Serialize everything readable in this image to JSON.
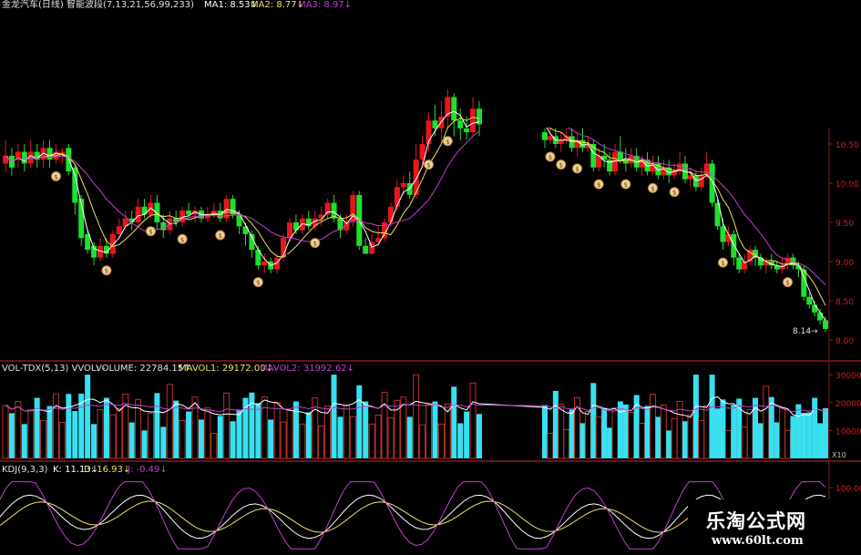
{
  "colors": {
    "up": "#e8161b",
    "down": "#1ee02e",
    "ma1": "#ffffff",
    "ma2": "#f0e060",
    "ma3": "#c040d0",
    "vol_up": "#c0302a",
    "vol_down": "#38e0f0",
    "axis": "#8b1a1a",
    "tick": "#cc2222",
    "kdj_k": "#ffffff",
    "kdj_d": "#f0e060",
    "kdj_j": "#c040d0"
  },
  "header": {
    "title": "金龙汽车(日线) 智能波段(7,13,21,56,99,233)",
    "ma1": "MA1: 8.53↓",
    "ma2": "MA2: 8.77↓",
    "ma3": "MA3: 8.97↓"
  },
  "vol_header": {
    "name": "VOL-TDX(5,13) VVOL: -",
    "volume": "VOLUME: 22784.15↑",
    "mavol1": "MAVOL1: 29172.00↓",
    "mavol2": "MAVOL2: 31992.62↓"
  },
  "kdj_header": {
    "name": "KDJ(9,3,3)",
    "k": "K: 11.13↓",
    "d": "D: 16.93↓",
    "j": "J: -0.49↓"
  },
  "watermark": {
    "name": "乐淘公式网",
    "url": "www.60lt.com"
  },
  "chart_data": [
    {
      "type": "candlestick",
      "title": "金龙汽车(日线) 智能波段(7,13,21,56,99,233)",
      "ylim": [
        7.95,
        10.75
      ],
      "yticks": [
        "10.50",
        "10.00",
        "9.50",
        "9.00",
        "8.50",
        "8.00"
      ],
      "last_price_label": "8.14",
      "candles": [
        [
          10.25,
          10.35,
          10.55,
          10.15
        ],
        [
          10.35,
          10.2,
          10.45,
          10.1
        ],
        [
          10.3,
          10.4,
          10.5,
          10.2
        ],
        [
          10.4,
          10.25,
          10.5,
          10.15
        ],
        [
          10.25,
          10.4,
          10.55,
          10.2
        ],
        [
          10.4,
          10.3,
          10.5,
          10.2
        ],
        [
          10.3,
          10.45,
          10.55,
          10.2
        ],
        [
          10.45,
          10.3,
          10.55,
          10.2
        ],
        [
          10.3,
          10.4,
          10.5,
          10.25
        ],
        [
          10.35,
          10.4,
          10.45,
          10.25
        ],
        [
          10.45,
          10.15,
          10.5,
          10.1
        ],
        [
          10.2,
          9.75,
          10.25,
          9.6
        ],
        [
          9.8,
          9.3,
          9.85,
          9.2
        ],
        [
          9.35,
          9.15,
          9.4,
          9.1
        ],
        [
          9.2,
          9.05,
          9.25,
          8.95
        ],
        [
          9.05,
          9.2,
          9.3,
          9.0
        ],
        [
          9.2,
          9.1,
          9.3,
          9.05
        ],
        [
          9.1,
          9.35,
          9.4,
          9.05
        ],
        [
          9.35,
          9.45,
          9.55,
          9.3
        ],
        [
          9.45,
          9.55,
          9.65,
          9.4
        ],
        [
          9.55,
          9.5,
          9.65,
          9.4
        ],
        [
          9.5,
          9.7,
          9.8,
          9.45
        ],
        [
          9.7,
          9.6,
          9.8,
          9.55
        ],
        [
          9.6,
          9.75,
          9.85,
          9.55
        ],
        [
          9.75,
          9.5,
          9.85,
          9.4
        ],
        [
          9.5,
          9.4,
          9.6,
          9.3
        ],
        [
          9.4,
          9.55,
          9.65,
          9.35
        ],
        [
          9.55,
          9.5,
          9.65,
          9.45
        ],
        [
          9.5,
          9.65,
          9.7,
          9.45
        ],
        [
          9.65,
          9.6,
          9.75,
          9.55
        ],
        [
          9.6,
          9.65,
          9.7,
          9.5
        ],
        [
          9.65,
          9.55,
          9.7,
          9.5
        ],
        [
          9.55,
          9.6,
          9.7,
          9.5
        ],
        [
          9.6,
          9.65,
          9.75,
          9.55
        ],
        [
          9.65,
          9.55,
          9.75,
          9.5
        ],
        [
          9.55,
          9.8,
          9.85,
          9.5
        ],
        [
          9.8,
          9.6,
          9.85,
          9.55
        ],
        [
          9.6,
          9.45,
          9.65,
          9.35
        ],
        [
          9.45,
          9.35,
          9.5,
          9.2
        ],
        [
          9.35,
          9.15,
          9.4,
          9.05
        ],
        [
          9.15,
          8.95,
          9.2,
          8.9
        ],
        [
          8.95,
          9.0,
          9.1,
          8.85
        ],
        [
          9.0,
          8.9,
          9.05,
          8.85
        ],
        [
          8.9,
          9.05,
          9.1,
          8.85
        ],
        [
          9.05,
          9.3,
          9.35,
          9.0
        ],
        [
          9.3,
          9.5,
          9.55,
          9.25
        ],
        [
          9.5,
          9.4,
          9.6,
          9.35
        ],
        [
          9.4,
          9.55,
          9.6,
          9.35
        ],
        [
          9.55,
          9.45,
          9.65,
          9.4
        ],
        [
          9.45,
          9.55,
          9.65,
          9.4
        ],
        [
          9.55,
          9.6,
          9.7,
          9.45
        ],
        [
          9.6,
          9.75,
          9.8,
          9.55
        ],
        [
          9.75,
          9.55,
          9.85,
          9.5
        ],
        [
          9.55,
          9.4,
          9.6,
          9.3
        ],
        [
          9.4,
          9.5,
          9.6,
          9.35
        ],
        [
          9.5,
          9.85,
          9.9,
          9.45
        ],
        [
          9.85,
          9.2,
          9.9,
          9.15
        ],
        [
          9.2,
          9.1,
          9.3,
          9.05
        ],
        [
          9.1,
          9.25,
          9.35,
          9.05
        ],
        [
          9.25,
          9.3,
          9.45,
          9.2
        ],
        [
          9.3,
          9.5,
          9.55,
          9.25
        ],
        [
          9.5,
          9.7,
          9.75,
          9.45
        ],
        [
          9.7,
          9.95,
          10.05,
          9.65
        ],
        [
          9.95,
          10.0,
          10.1,
          9.85
        ],
        [
          10.0,
          9.85,
          10.15,
          9.8
        ],
        [
          9.85,
          10.3,
          10.5,
          9.8
        ],
        [
          10.3,
          10.5,
          10.6,
          10.2
        ],
        [
          10.5,
          10.8,
          10.9,
          10.4
        ],
        [
          10.8,
          10.7,
          11.0,
          10.6
        ],
        [
          10.7,
          10.85,
          11.05,
          10.5
        ],
        [
          10.85,
          11.1,
          11.2,
          10.7
        ],
        [
          11.1,
          10.8,
          11.15,
          10.6
        ],
        [
          10.8,
          10.7,
          10.95,
          10.55
        ],
        [
          10.7,
          10.65,
          10.85,
          10.55
        ],
        [
          10.65,
          10.95,
          11.1,
          10.6
        ],
        [
          10.95,
          10.75,
          11.05,
          10.6
        ]
      ],
      "candles2": [
        [
          10.65,
          10.55,
          10.7,
          10.45
        ],
        [
          10.55,
          10.6,
          10.7,
          10.5
        ],
        [
          10.6,
          10.5,
          10.7,
          10.45
        ],
        [
          10.5,
          10.55,
          10.65,
          10.4
        ],
        [
          10.55,
          10.6,
          10.7,
          10.5
        ],
        [
          10.6,
          10.45,
          10.7,
          10.4
        ],
        [
          10.45,
          10.55,
          10.65,
          10.35
        ],
        [
          10.55,
          10.45,
          10.7,
          10.4
        ],
        [
          10.45,
          10.5,
          10.6,
          10.4
        ],
        [
          10.5,
          10.2,
          10.55,
          10.15
        ],
        [
          10.2,
          10.35,
          10.45,
          10.15
        ],
        [
          10.35,
          10.3,
          10.5,
          10.2
        ],
        [
          10.3,
          10.15,
          10.4,
          10.1
        ],
        [
          10.15,
          10.4,
          10.5,
          10.1
        ],
        [
          10.4,
          10.3,
          10.6,
          10.25
        ],
        [
          10.3,
          10.25,
          10.45,
          10.15
        ],
        [
          10.25,
          10.35,
          10.45,
          10.2
        ],
        [
          10.35,
          10.2,
          10.45,
          10.15
        ],
        [
          10.2,
          10.3,
          10.35,
          10.1
        ],
        [
          10.3,
          10.15,
          10.4,
          10.1
        ],
        [
          10.15,
          10.25,
          10.35,
          10.1
        ],
        [
          10.25,
          10.1,
          10.35,
          10.05
        ],
        [
          10.1,
          10.2,
          10.3,
          10.05
        ],
        [
          10.2,
          10.1,
          10.3,
          10.0
        ],
        [
          10.1,
          10.15,
          10.25,
          10.05
        ],
        [
          10.15,
          10.25,
          10.4,
          10.1
        ],
        [
          10.25,
          10.05,
          10.35,
          10.0
        ],
        [
          10.05,
          10.1,
          10.2,
          9.95
        ],
        [
          10.1,
          9.95,
          10.15,
          9.9
        ],
        [
          9.95,
          10.1,
          10.2,
          9.9
        ],
        [
          10.1,
          10.25,
          10.4,
          10.05
        ],
        [
          10.25,
          9.75,
          10.3,
          9.7
        ],
        [
          9.75,
          9.45,
          9.8,
          9.4
        ],
        [
          9.45,
          9.25,
          9.55,
          9.15
        ],
        [
          9.25,
          9.35,
          9.45,
          9.2
        ],
        [
          9.35,
          9.05,
          9.4,
          8.95
        ],
        [
          9.05,
          8.9,
          9.1,
          8.85
        ],
        [
          8.9,
          9.0,
          9.1,
          8.85
        ],
        [
          9.0,
          9.15,
          9.2,
          8.95
        ],
        [
          9.15,
          9.05,
          9.2,
          8.95
        ],
        [
          9.05,
          8.95,
          9.1,
          8.9
        ],
        [
          8.95,
          9.0,
          9.05,
          8.85
        ],
        [
          9.0,
          8.95,
          9.1,
          8.9
        ],
        [
          8.95,
          8.9,
          9.0,
          8.85
        ],
        [
          8.9,
          8.95,
          9.05,
          8.85
        ],
        [
          8.95,
          9.05,
          9.1,
          8.9
        ],
        [
          9.05,
          8.95,
          9.1,
          8.9
        ],
        [
          8.95,
          8.9,
          9.0,
          8.8
        ],
        [
          8.9,
          8.55,
          8.95,
          8.5
        ],
        [
          8.55,
          8.45,
          8.6,
          8.4
        ],
        [
          8.45,
          8.35,
          8.5,
          8.3
        ],
        [
          8.35,
          8.25,
          8.4,
          8.2
        ],
        [
          8.25,
          8.14,
          8.3,
          8.1
        ]
      ],
      "series": [
        {
          "name": "MA1"
        },
        {
          "name": "MA2"
        },
        {
          "name": "MA3"
        }
      ]
    },
    {
      "type": "bar",
      "title": "VOL-TDX(5,13)",
      "ylim": [
        0,
        32000
      ],
      "yticks": [
        "30000",
        "20000",
        "10000"
      ],
      "volume_unit": "X10",
      "series": [
        {
          "name": "VOLUME"
        },
        {
          "name": "MAVOL1"
        },
        {
          "name": "MAVOL2"
        }
      ]
    },
    {
      "type": "line",
      "title": "KDJ(9,3,3)",
      "ylim": [
        0,
        100
      ],
      "yticks": [
        "100.00",
        "50.00"
      ],
      "series": [
        {
          "name": "K"
        },
        {
          "name": "D"
        },
        {
          "name": "J"
        }
      ]
    }
  ]
}
